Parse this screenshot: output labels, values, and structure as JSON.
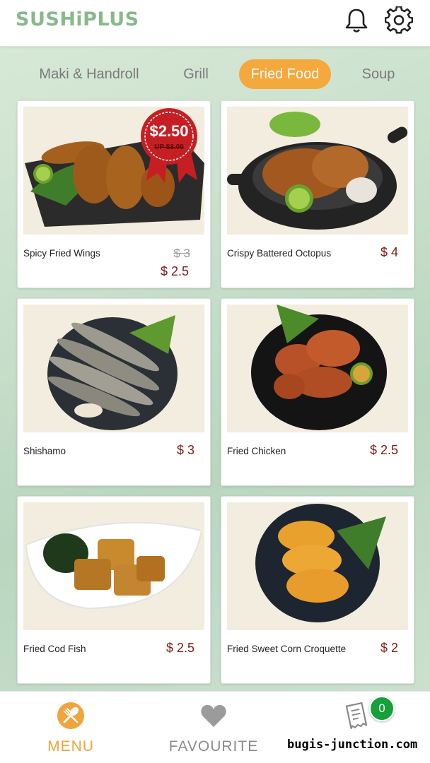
{
  "app": {
    "logo": "SUSHiPLUS"
  },
  "header": {
    "icons": [
      "bell-icon",
      "gear-icon"
    ]
  },
  "categories": [
    {
      "label": "Maki & Handroll",
      "active": false
    },
    {
      "label": "Grill",
      "active": false
    },
    {
      "label": "Fried Food",
      "active": true
    },
    {
      "label": "Soup",
      "active": false
    }
  ],
  "items": [
    {
      "name": "Spicy Fried Wings",
      "old_price": "$ 3",
      "price": "$ 2.5",
      "promo": {
        "price": "$2.50",
        "was": "UP $3.00"
      }
    },
    {
      "name": "Crispy Battered Octopus",
      "price": "$ 4"
    },
    {
      "name": "Shishamo",
      "price": "$ 3"
    },
    {
      "name": "Fried Chicken",
      "price": "$ 2.5"
    },
    {
      "name": "Fried Cod Fish",
      "price": "$ 2.5"
    },
    {
      "name": "Fried Sweet Corn Croquette",
      "price": "$ 2"
    }
  ],
  "bottom_nav": {
    "menu": "MENU",
    "favourite": "FAVOURITE",
    "order_count": "0"
  },
  "colors": {
    "accent": "#f5a83c",
    "brand": "#87b98d",
    "price": "#7d1b1b",
    "badge": "#16a03a"
  },
  "watermark": "bugis-junction.com"
}
